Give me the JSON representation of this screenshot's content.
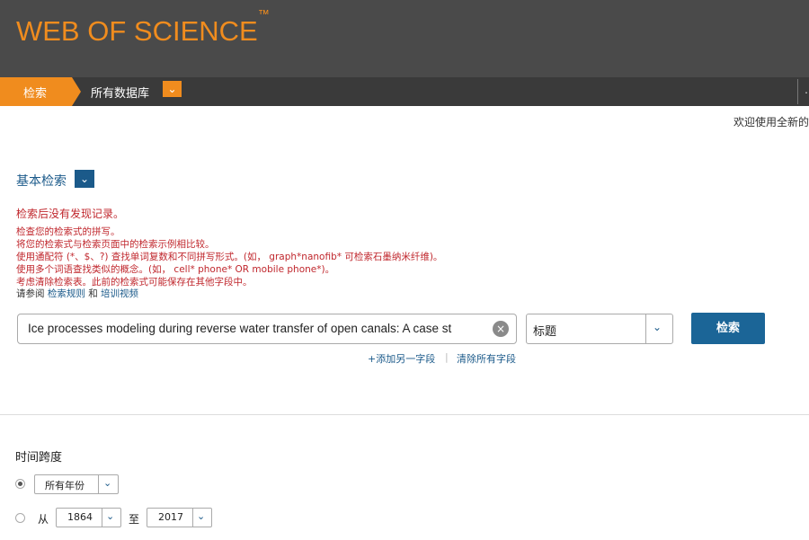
{
  "header": {
    "brand": "WEB OF SCIENCE",
    "trademark": "™"
  },
  "nav": {
    "search_tab": "检索",
    "database_label": "所有数据库",
    "database_dropdown_icon": "chevron-down-icon",
    "right_text": "…"
  },
  "welcome_text": "欢迎使用全新的",
  "basic_search": {
    "label": "基本检索",
    "dropdown_icon": "chevron-down-icon"
  },
  "error": {
    "title": "检索后没有发现记录。",
    "lines": [
      "检查您的检索式的拼写。",
      "将您的检索式与检索页面中的检索示例相比较。",
      "使用通配符 (*、$、?) 查找单词复数和不同拼写形式。(如， graph*nanofib* 可检索石墨纳米纤维)。",
      "使用多个词语查找类似的概念。(如， cell* phone* OR mobile phone*)。",
      "考虑清除检索表。此前的检索式可能保存在其他字段中。"
    ],
    "help_prefix": "请参阅",
    "help_link_rules": "检索规则",
    "help_and": "和",
    "help_link_training": "培训视频"
  },
  "search": {
    "query_value": "Ice processes modeling during reverse water transfer of open canals: A case st",
    "field_value": "标题",
    "button_label": "检索",
    "add_field": "+添加另一字段",
    "separator": "|",
    "clear_all": "清除所有字段"
  },
  "timespan": {
    "label": "时间跨度",
    "all_years": "所有年份",
    "from_label": "从",
    "from_year": "1864",
    "to_label": "至",
    "to_year": "2017",
    "selected_option": "all_years"
  },
  "colors": {
    "header_bg": "#4a4a4a",
    "nav_bg": "#3a3a3a",
    "accent_orange": "#f08c1e",
    "link_blue": "#1b5a8a",
    "error_red": "#c0272d",
    "button_blue": "#1b6597"
  }
}
